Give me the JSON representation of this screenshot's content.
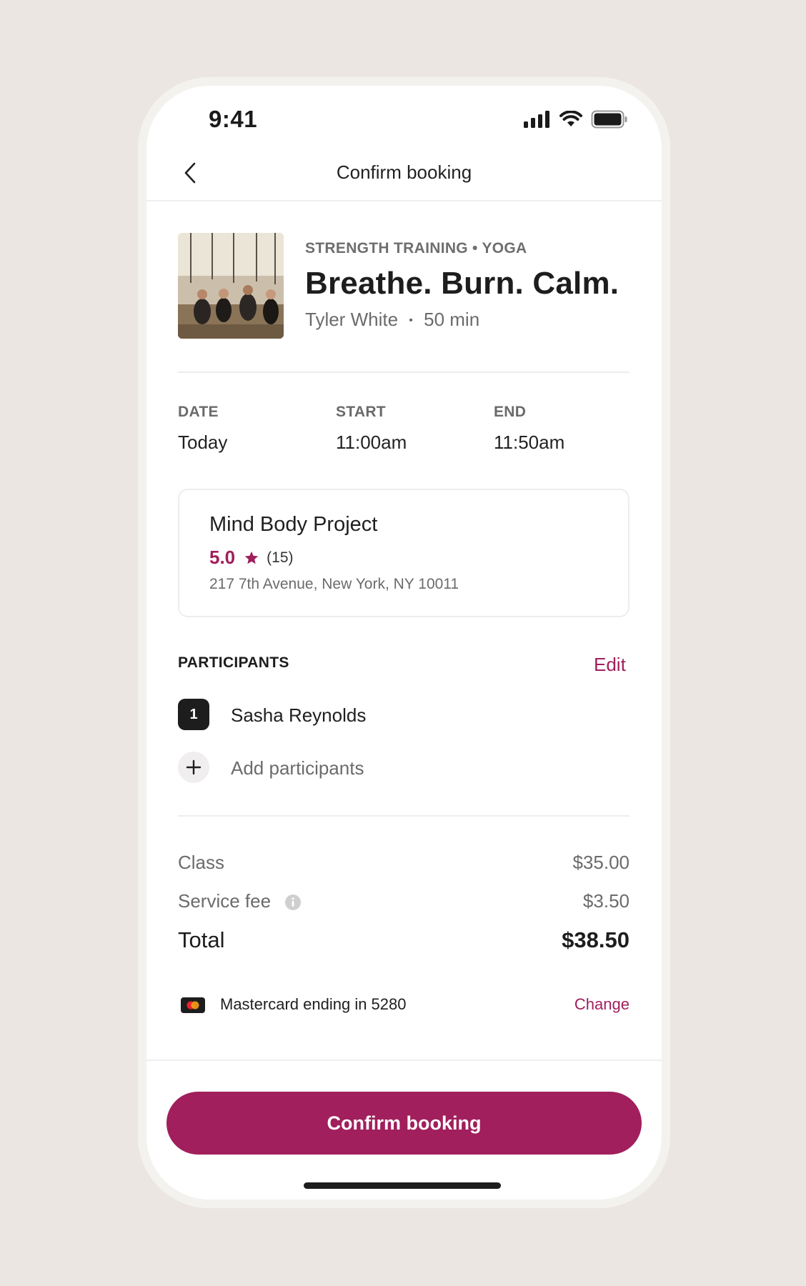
{
  "status_bar": {
    "time": "9:41",
    "icons": [
      "signal-icon",
      "wifi-icon",
      "battery-icon"
    ]
  },
  "nav": {
    "back_icon": "chevron-left-icon",
    "title": "Confirm booking"
  },
  "class": {
    "category": "STRENGTH TRAINING • YOGA",
    "title": "Breathe. Burn. Calm.",
    "instructor": "Tyler White",
    "separator": "•",
    "duration": "50 min"
  },
  "schedule": {
    "date_label": "DATE",
    "date_value": "Today",
    "start_label": "START",
    "start_value": "11:00am",
    "end_label": "END",
    "end_value": "11:50am"
  },
  "venue": {
    "name": "Mind Body Project",
    "rating": "5.0",
    "rating_icon": "star-icon",
    "review_count": "(15)",
    "address": "217 7th Avenue, New York, NY 10011"
  },
  "participants": {
    "title": "PARTICIPANTS",
    "edit_label": "Edit",
    "list": [
      {
        "number": "1",
        "name": "Sasha Reynolds"
      }
    ],
    "add_label": "Add participants"
  },
  "pricing": {
    "class_label": "Class",
    "class_value": "$35.00",
    "fee_label": "Service fee",
    "fee_value": "$3.50",
    "total_label": "Total",
    "total_value": "$38.50"
  },
  "payment": {
    "card_label": "Mastercard ending in 5280",
    "change_label": "Change"
  },
  "cta": {
    "confirm_label": "Confirm booking"
  },
  "colors": {
    "accent": "#a01f5c",
    "background": "#ebe6e1"
  }
}
